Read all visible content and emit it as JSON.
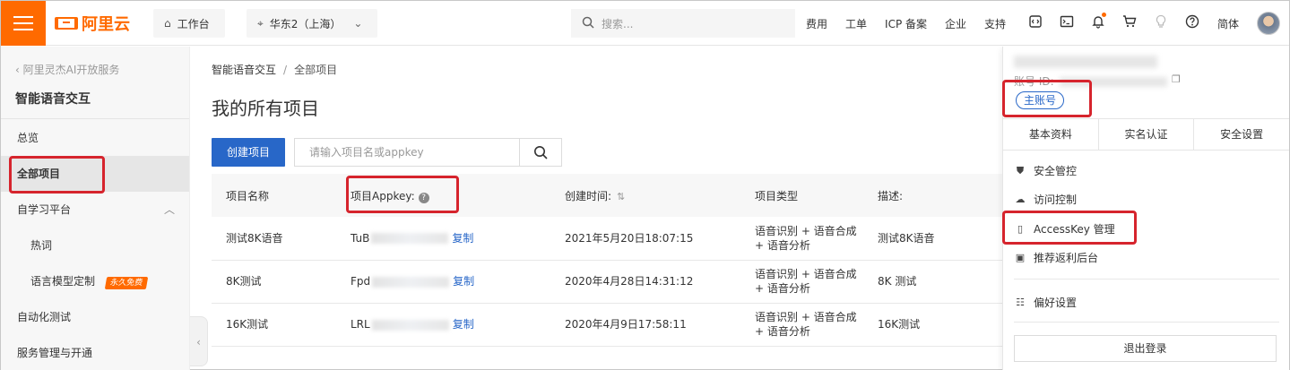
{
  "topbar": {
    "brand": "阿里云",
    "workbench": "工作台",
    "region": "华东2（上海）",
    "search_placeholder": "搜索...",
    "links": [
      "费用",
      "工单",
      "ICP 备案",
      "企业",
      "支持"
    ],
    "language": "简体"
  },
  "sidebar": {
    "back_label": "阿里灵杰AI开放服务",
    "title": "智能语音交互",
    "items": {
      "overview": "总览",
      "all_projects": "全部项目",
      "self_learning": "自学习平台",
      "hot_words": "热词",
      "lm_custom": "语言模型定制",
      "lm_badge": "永久免费",
      "auto_test": "自动化测试",
      "service": "服务管理与开通"
    }
  },
  "main": {
    "breadcrumb": {
      "root": "智能语音交互",
      "current": "全部项目"
    },
    "title": "我的所有项目",
    "create_button": "创建项目",
    "search_placeholder": "请输入项目名或appkey",
    "table": {
      "headers": {
        "name": "项目名称",
        "appkey": "项目Appkey:",
        "created": "创建时间:",
        "type": "项目类型",
        "desc": "描述:"
      },
      "copy_label": "复制",
      "rows": [
        {
          "name": "测试8K语音",
          "appkey_prefix": "TuB",
          "created": "2021年5月20日18:07:15",
          "type": "语音识别 + 语音合成 + 语音分析",
          "desc": "测试8K语音"
        },
        {
          "name": "8K测试",
          "appkey_prefix": "Fpd",
          "created": "2020年4月28日14:31:12",
          "type": "语音识别 + 语音合成 + 语音分析",
          "desc": "8K 测试"
        },
        {
          "name": "16K测试",
          "appkey_prefix": "LRL",
          "created": "2020年4月9日17:58:11",
          "type": "语音识别 + 语音合成 + 语音分析",
          "desc": "16K测试"
        }
      ]
    }
  },
  "account_menu": {
    "account_id_label": "账号 ID:",
    "main_account_badge": "主账号",
    "tabs": [
      "基本资料",
      "实名认证",
      "安全设置"
    ],
    "items": {
      "security": "安全管控",
      "access": "访问控制",
      "accesskey": "AccessKey 管理",
      "referral": "推荐返利后台",
      "preferences": "偏好设置"
    },
    "logout": "退出登录"
  }
}
